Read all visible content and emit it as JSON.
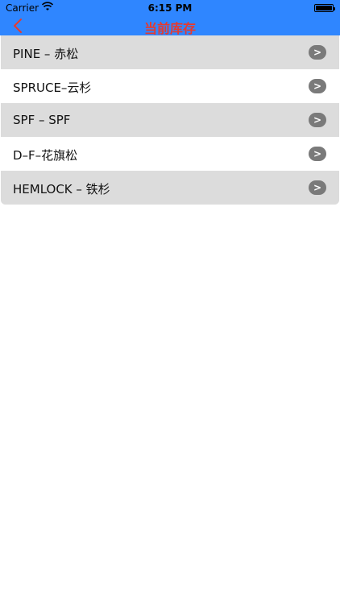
{
  "status_bar": {
    "carrier": "Carrier",
    "time": "6:15 PM"
  },
  "nav": {
    "title": "当前库存",
    "back_icon": "chevron-left-icon",
    "title_color": "#e63a2e",
    "bar_color": "#2f86ff"
  },
  "list": {
    "items": [
      {
        "label": "PINE – 赤松",
        "disclosure": ">"
      },
      {
        "label": "SPRUCE–云杉",
        "disclosure": ">"
      },
      {
        "label": "SPF – SPF",
        "disclosure": ">"
      },
      {
        "label": "D–F–花旗松",
        "disclosure": ">"
      },
      {
        "label": "HEMLOCK – 铁杉",
        "disclosure": ">"
      }
    ]
  }
}
